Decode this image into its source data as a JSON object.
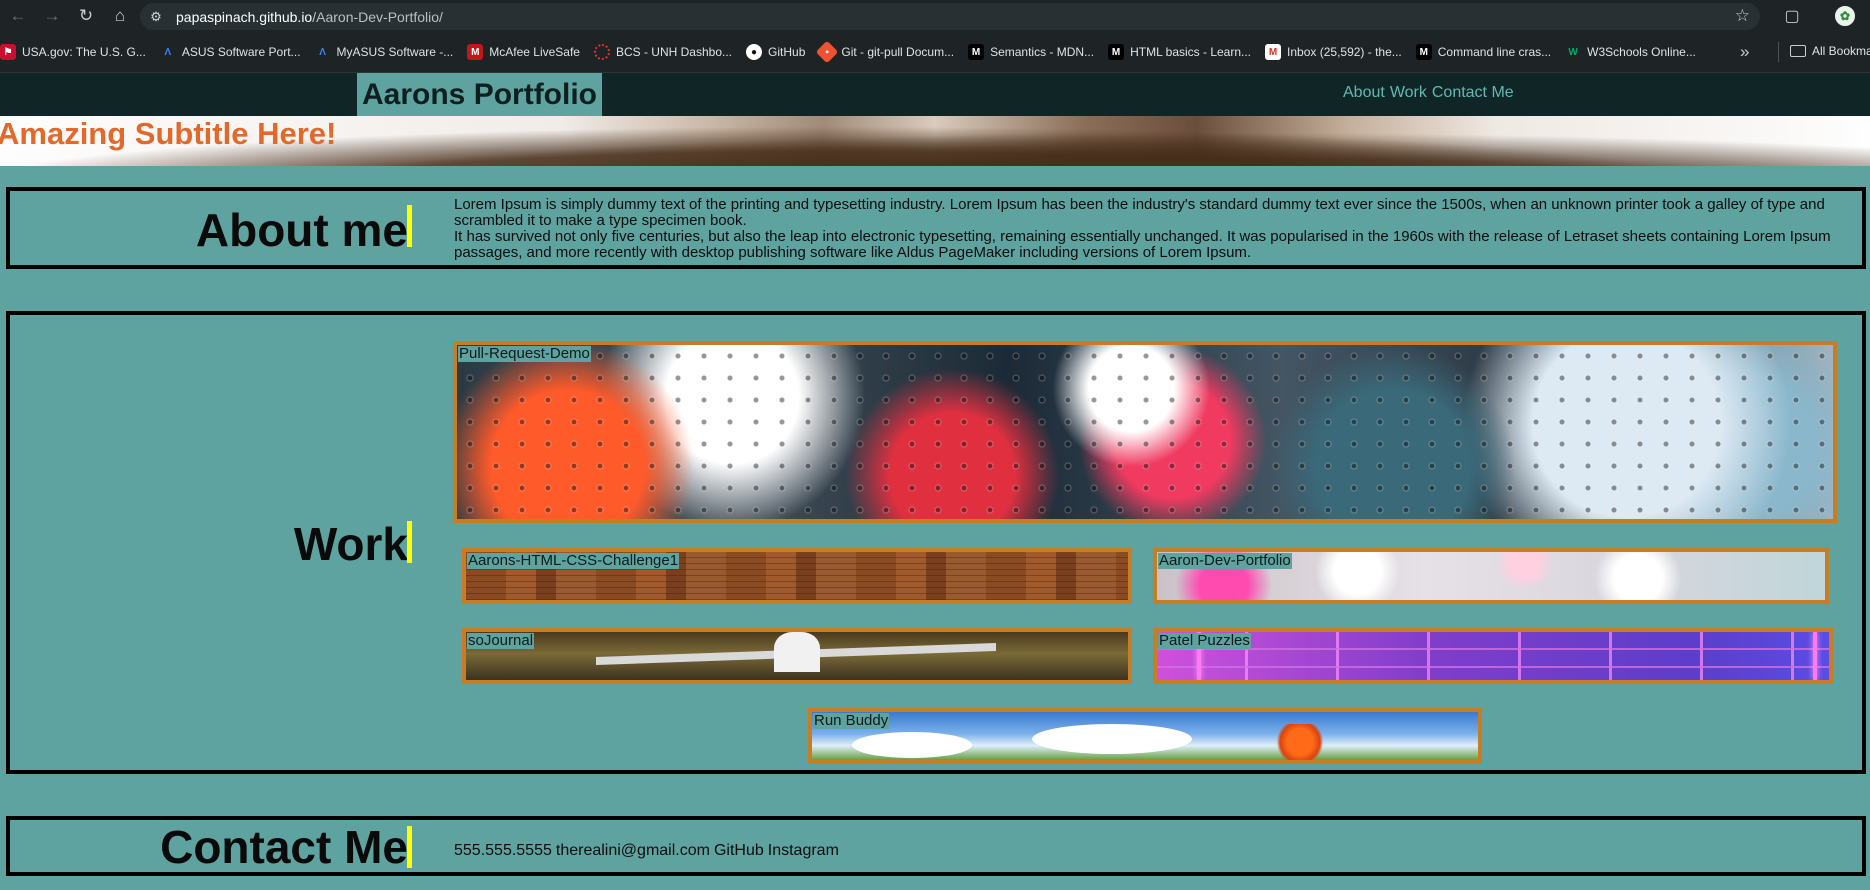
{
  "browser": {
    "url_host": "papaspinach.github.io",
    "url_path": "/Aaron-Dev-Portfolio/",
    "bookmarks": [
      "USA.gov: The U.S. G...",
      "ASUS Software Port...",
      "MyASUS Software -...",
      "McAfee LiveSafe",
      "BCS - UNH Dashbo...",
      "GitHub",
      "Git - git-pull Docum...",
      "Semantics - MDN...",
      "HTML basics - Learn...",
      "Inbox (25,592) - the...",
      "Command line cras...",
      "W3Schools Online..."
    ],
    "all_bookmarks": "All Bookmarks"
  },
  "site": {
    "title": "Aarons Portfolio",
    "nav": {
      "about": "About",
      "work": "Work",
      "contact": "Contact Me"
    },
    "subtitle": "Amazing Subtitle Here!"
  },
  "about": {
    "heading": "About me",
    "paragraph1": "Lorem Ipsum is simply dummy text of the printing and typesetting industry. Lorem Ipsum has been the industry's standard dummy text ever since the 1500s, when an unknown printer took a galley of type and scrambled it to make a type specimen book.",
    "paragraph2": "It has survived not only five centuries, but also the leap into electronic typesetting, remaining essentially unchanged. It was popularised in the 1960s with the release of Letraset sheets containing Lorem Ipsum passages, and more recently with desktop publishing software like Aldus PageMaker including versions of Lorem Ipsum."
  },
  "work": {
    "heading": "Work",
    "projects": [
      "Pull-Request-Demo",
      "Aarons-HTML-CSS-Challenge1",
      "Aaron-Dev-Portfolio",
      "soJournal",
      "Patel Puzzles",
      "Run Buddy"
    ]
  },
  "contact": {
    "heading": "Contact Me",
    "phone": "555.555.5555",
    "email": "therealini@gmail.com",
    "github": "GitHub",
    "instagram": "Instagram"
  }
}
